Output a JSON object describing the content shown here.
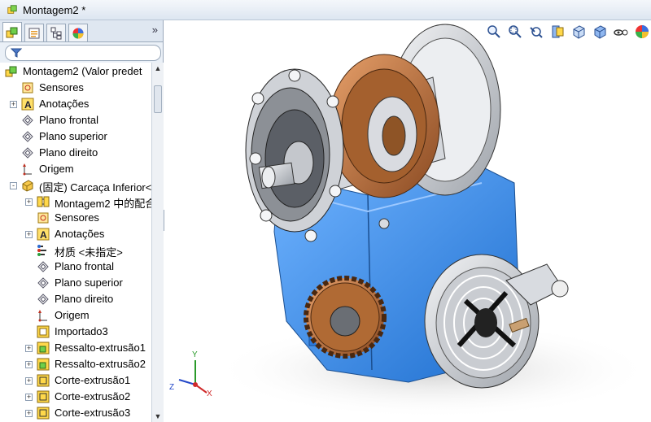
{
  "window": {
    "title": "Montagem2 *"
  },
  "panel": {
    "tabs": [
      "feature-manager",
      "property-manager",
      "configuration-manager",
      "display-manager"
    ],
    "expand_label": "»"
  },
  "tree": {
    "items": [
      {
        "label": "Montagem2  (Valor predet",
        "icon": "assembly-icon",
        "level": 0,
        "expander": ""
      },
      {
        "label": "Sensores",
        "icon": "sensor-icon",
        "level": 1,
        "expander": ""
      },
      {
        "label": "Anotações",
        "icon": "annotation-icon",
        "level": 1,
        "expander": "+"
      },
      {
        "label": "Plano frontal",
        "icon": "plane-icon",
        "level": 1,
        "expander": ""
      },
      {
        "label": "Plano superior",
        "icon": "plane-icon",
        "level": 1,
        "expander": ""
      },
      {
        "label": "Plano direito",
        "icon": "plane-icon",
        "level": 1,
        "expander": ""
      },
      {
        "label": "Origem",
        "icon": "origin-icon",
        "level": 1,
        "expander": ""
      },
      {
        "label": "(固定) Carcaça Inferior<",
        "icon": "part-icon",
        "level": 1,
        "expander": "-"
      },
      {
        "label": "Montagem2 中的配合",
        "icon": "mates-icon",
        "level": 2,
        "expander": "+"
      },
      {
        "label": "Sensores",
        "icon": "sensor-icon",
        "level": 2,
        "expander": ""
      },
      {
        "label": "Anotações",
        "icon": "annotation-icon",
        "level": 2,
        "expander": "+"
      },
      {
        "label": "材质 <未指定>",
        "icon": "material-icon",
        "level": 2,
        "expander": ""
      },
      {
        "label": "Plano frontal",
        "icon": "plane-icon",
        "level": 2,
        "expander": ""
      },
      {
        "label": "Plano superior",
        "icon": "plane-icon",
        "level": 2,
        "expander": ""
      },
      {
        "label": "Plano direito",
        "icon": "plane-icon",
        "level": 2,
        "expander": ""
      },
      {
        "label": "Origem",
        "icon": "origin-icon",
        "level": 2,
        "expander": ""
      },
      {
        "label": "Importado3",
        "icon": "imported-icon",
        "level": 2,
        "expander": ""
      },
      {
        "label": "Ressalto-extrusão1",
        "icon": "boss-extrude-icon",
        "level": 2,
        "expander": "+"
      },
      {
        "label": "Ressalto-extrusão2",
        "icon": "boss-extrude-icon",
        "level": 2,
        "expander": "+"
      },
      {
        "label": "Corte-extrusão1",
        "icon": "cut-extrude-icon",
        "level": 2,
        "expander": "+"
      },
      {
        "label": "Corte-extrusão2",
        "icon": "cut-extrude-icon",
        "level": 2,
        "expander": "+"
      },
      {
        "label": "Corte-extrusão3",
        "icon": "cut-extrude-icon",
        "level": 2,
        "expander": "+"
      }
    ]
  },
  "viewport": {
    "toolbar": [
      "zoom-to-fit-icon",
      "zoom-to-area-icon",
      "previous-view-icon",
      "section-view-icon",
      "view-orientation-icon",
      "display-style-icon",
      "hide-show-items-icon",
      "appearance-icon"
    ],
    "triad_labels": {
      "x": "X",
      "y": "Y",
      "z": "Z"
    },
    "colors": {
      "housing": "#3b8ee8",
      "gear": "#c0703a",
      "steel": "#d6d9dd"
    }
  }
}
